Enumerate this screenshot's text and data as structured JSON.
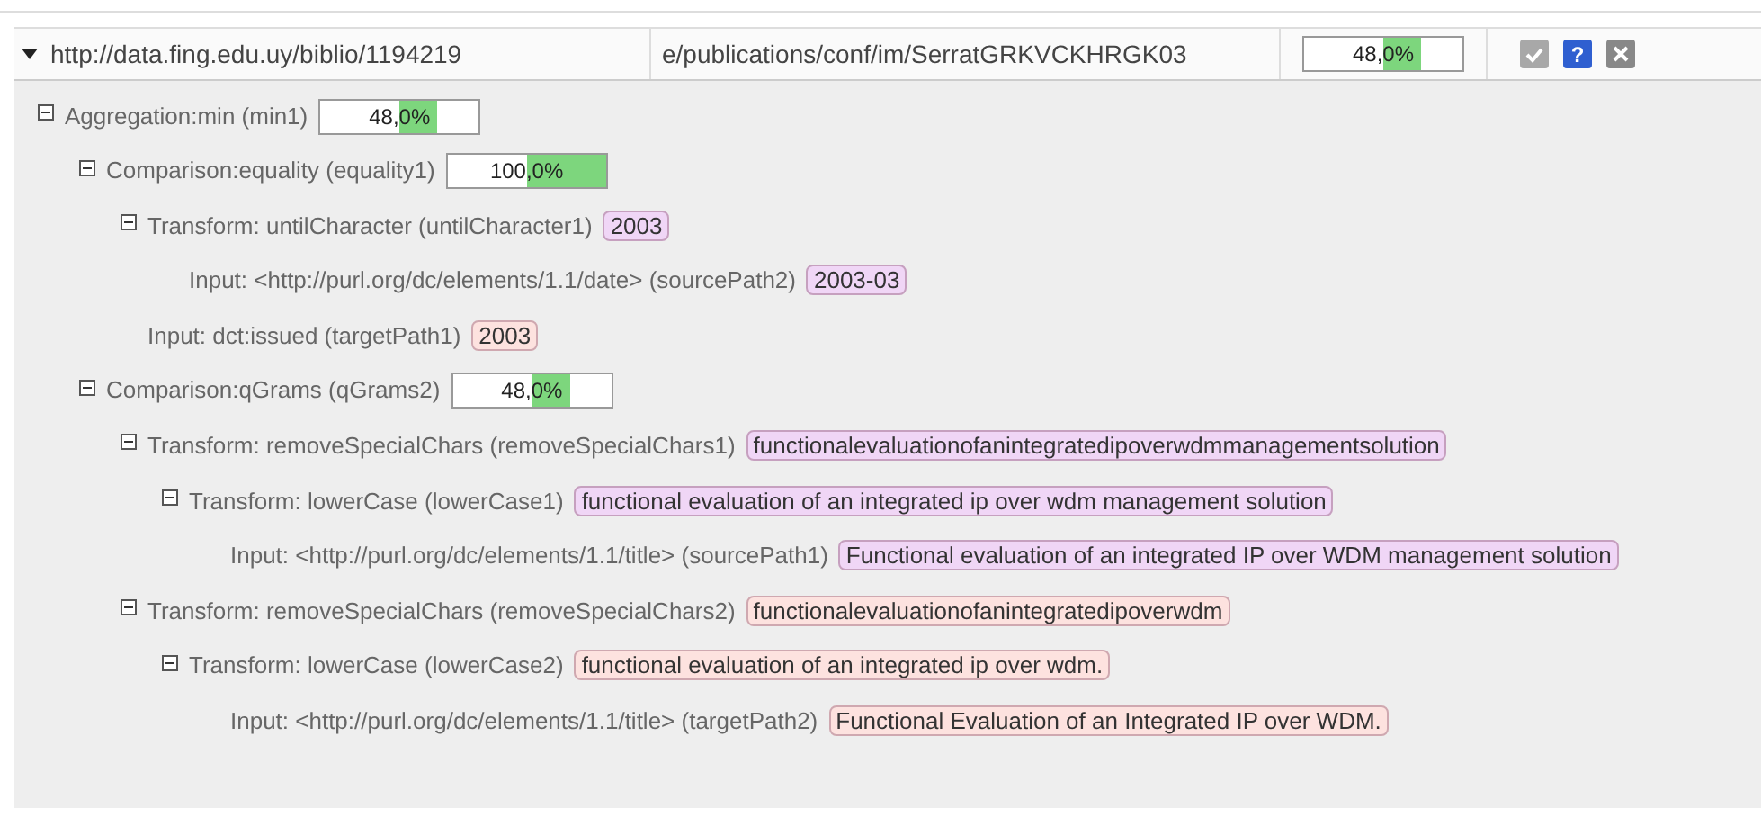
{
  "header": {
    "source_uri": "http://data.fing.edu.uy/biblio/1194219",
    "target_uri": "e/publications/conf/im/SerratGRKVCKHRGK03",
    "score": {
      "text": "48,0%",
      "level": 0.48
    },
    "help_glyph": "?"
  },
  "tree": [
    {
      "label": "Aggregation:min (min1)",
      "expanded": true,
      "score": {
        "text": "48,0%",
        "level": 0.48
      },
      "children": [
        {
          "label": "Comparison:equality (equality1)",
          "expanded": true,
          "score": {
            "text": "100,0%",
            "level": 1.0
          },
          "children": [
            {
              "label": "Transform: untilCharacter (untilCharacter1)",
              "expanded": true,
              "value": {
                "text": "2003",
                "color": "#f0d6f6"
              },
              "children": [
                {
                  "label": "Input: <http://purl.org/dc/elements/1.1/date> (sourcePath2)",
                  "value": {
                    "text": "2003-03",
                    "color": "#f0d6f6"
                  }
                }
              ]
            },
            {
              "label": "Input: dct:issued (targetPath1)",
              "value": {
                "text": "2003",
                "color": "#fde2df"
              }
            }
          ]
        },
        {
          "label": "Comparison:qGrams (qGrams2)",
          "expanded": true,
          "score": {
            "text": "48,0%",
            "level": 0.48
          },
          "children": [
            {
              "label": "Transform: removeSpecialChars (removeSpecialChars1)",
              "expanded": true,
              "value": {
                "text": "functionalevaluationofanintegratedipoverwdmmanagementsolution",
                "color": "#f0d6f6"
              },
              "children": [
                {
                  "label": "Transform: lowerCase (lowerCase1)",
                  "expanded": true,
                  "value": {
                    "text": "functional evaluation of an integrated ip over wdm management solution",
                    "color": "#f0d6f6"
                  },
                  "children": [
                    {
                      "label": "Input: <http://purl.org/dc/elements/1.1/title> (sourcePath1)",
                      "value": {
                        "text": "Functional evaluation of an integrated IP over WDM management solution",
                        "color": "#f0d6f6"
                      }
                    }
                  ]
                }
              ]
            },
            {
              "label": "Transform: removeSpecialChars (removeSpecialChars2)",
              "expanded": true,
              "value": {
                "text": "functionalevaluationofanintegratedipoverwdm",
                "color": "#fde2df"
              },
              "children": [
                {
                  "label": "Transform: lowerCase (lowerCase2)",
                  "expanded": true,
                  "value": {
                    "text": "functional evaluation of an integrated ip over wdm.",
                    "color": "#fde2df"
                  },
                  "children": [
                    {
                      "label": "Input: <http://purl.org/dc/elements/1.1/title> (targetPath2)",
                      "value": {
                        "text": "Functional Evaluation of an Integrated IP over WDM.",
                        "color": "#fde2df"
                      }
                    }
                  ]
                }
              ]
            }
          ]
        }
      ]
    }
  ]
}
